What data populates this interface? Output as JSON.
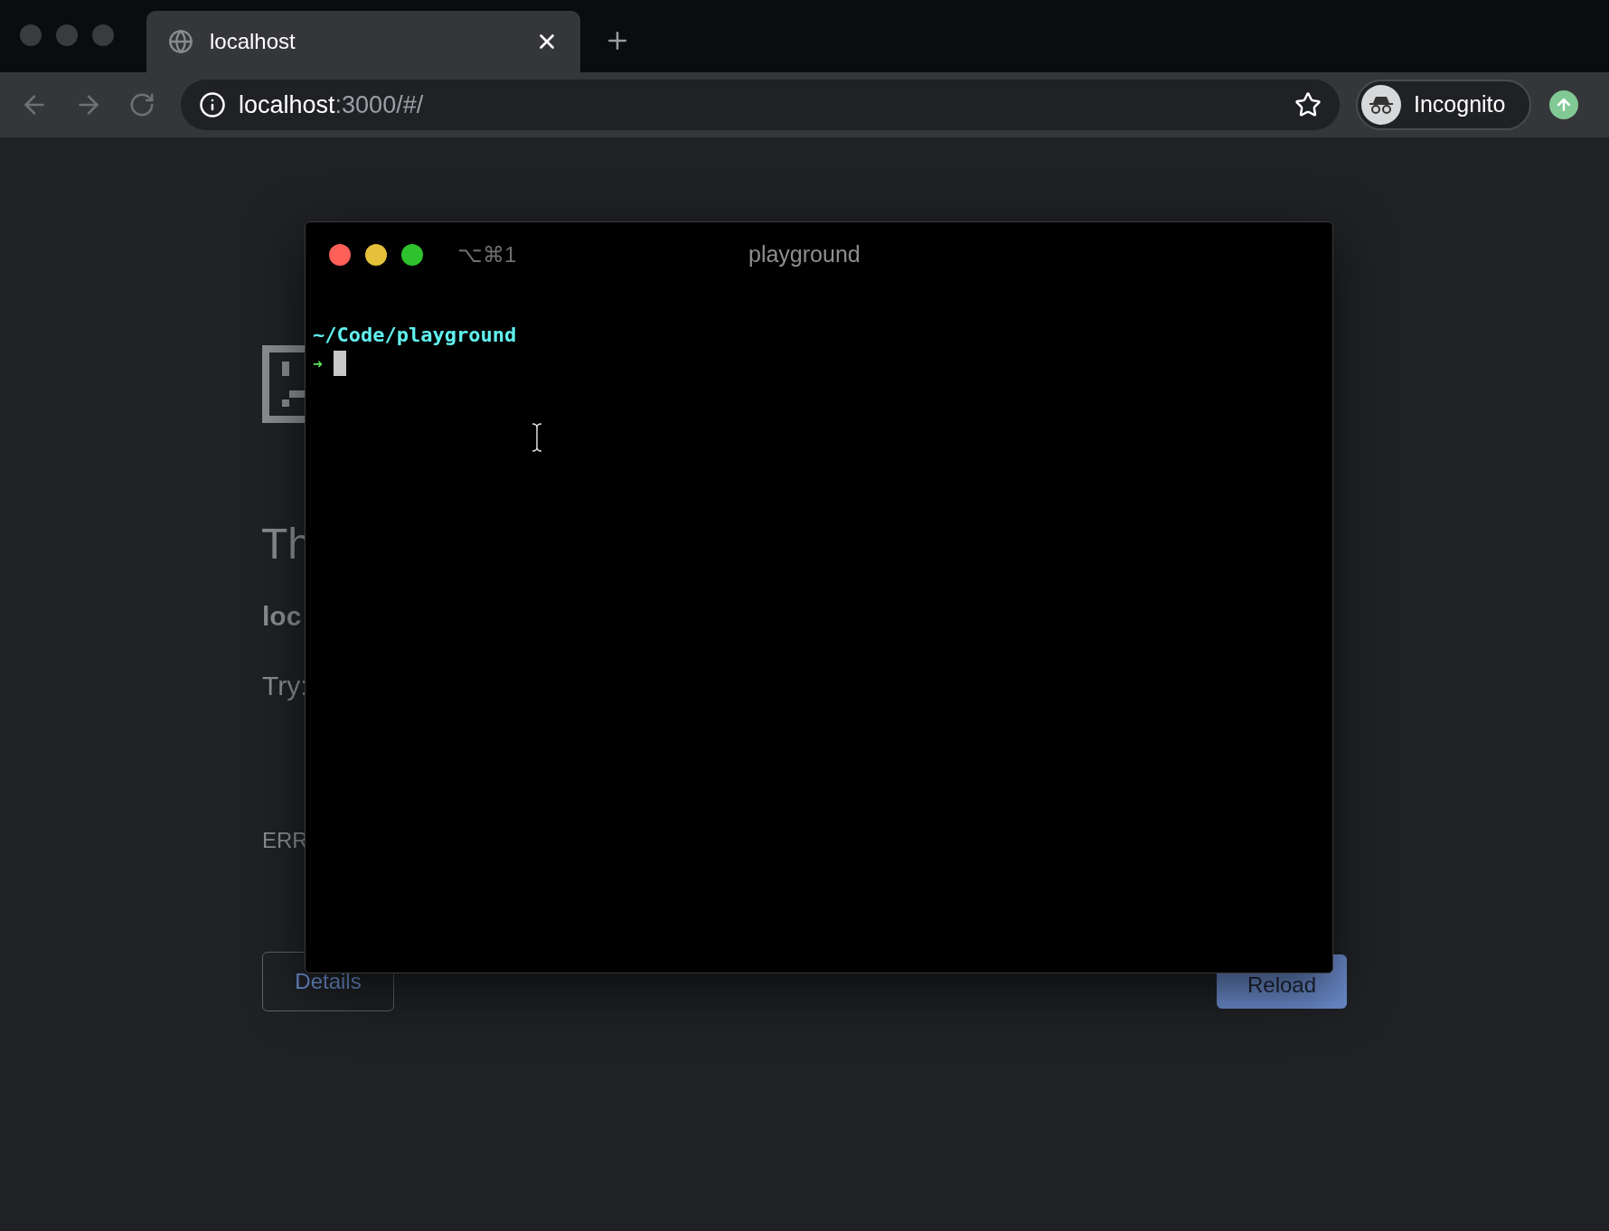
{
  "browser": {
    "tabs": [
      {
        "title": "localhost",
        "selected": true
      }
    ],
    "address": {
      "host": "localhost",
      "rest": ":3000/#/"
    },
    "profile": {
      "label": "Incognito"
    }
  },
  "page": {
    "heading": "Th",
    "host": "loc",
    "try_label": "Try:",
    "error_code": "ERR",
    "buttons": [
      {
        "label": "Details",
        "kind": "secondary"
      },
      {
        "label": "Reload",
        "kind": "primary"
      }
    ]
  },
  "terminal": {
    "shortcut": "⌥⌘1",
    "title": "playground",
    "cwd": "~/Code/playground",
    "prompt": "➜"
  }
}
